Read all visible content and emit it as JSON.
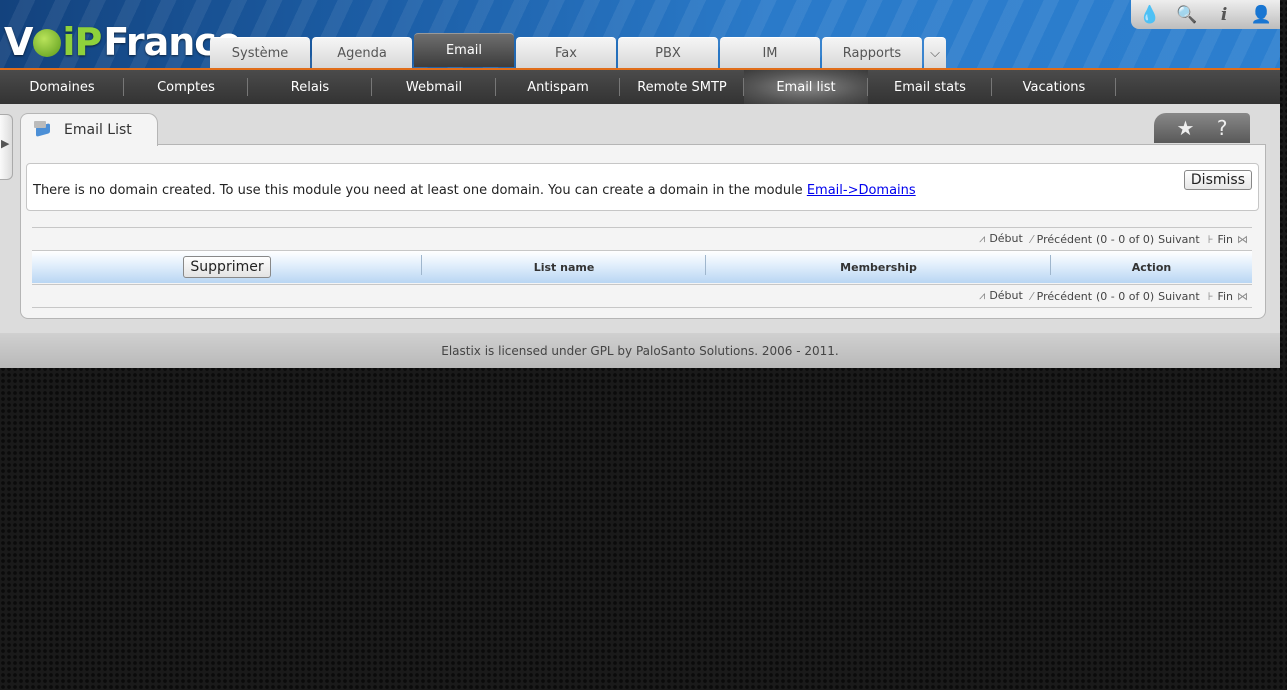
{
  "brand": {
    "logo_v": "V",
    "logo_ip": "iP",
    "logo_france": "France"
  },
  "tools": [
    {
      "icon": "drop-icon",
      "glyph": "💧"
    },
    {
      "icon": "search-icon",
      "glyph": "🔍"
    },
    {
      "icon": "info-icon",
      "glyph": "i"
    },
    {
      "icon": "user-icon",
      "glyph": "👤"
    }
  ],
  "main_tabs": [
    "Système",
    "Agenda",
    "Email",
    "Fax",
    "PBX",
    "IM",
    "Rapports"
  ],
  "main_tab_active": "Email",
  "sub_nav": [
    "Domaines",
    "Comptes",
    "Relais",
    "Webmail",
    "Antispam",
    "Remote SMTP",
    "Email list",
    "Email stats",
    "Vacations"
  ],
  "sub_nav_active": "Email list",
  "module": {
    "title": "Email List",
    "star_glyph": "★",
    "help_glyph": "?"
  },
  "message": {
    "text": "There is no domain created. To use this module you need at least one domain. You can create a domain in the module ",
    "link": "Email->Domains",
    "dismiss": "Dismiss"
  },
  "pager": {
    "first": "Début",
    "prev": "Précédent",
    "range": "(0 - 0 of 0)",
    "next": "Suivant",
    "last": "Fin"
  },
  "table": {
    "delete_button": "Supprimer",
    "columns": [
      "List name",
      "Membership",
      "Action"
    ]
  },
  "footer": "Elastix is licensed under GPL by PaloSanto Solutions. 2006 - 2011."
}
